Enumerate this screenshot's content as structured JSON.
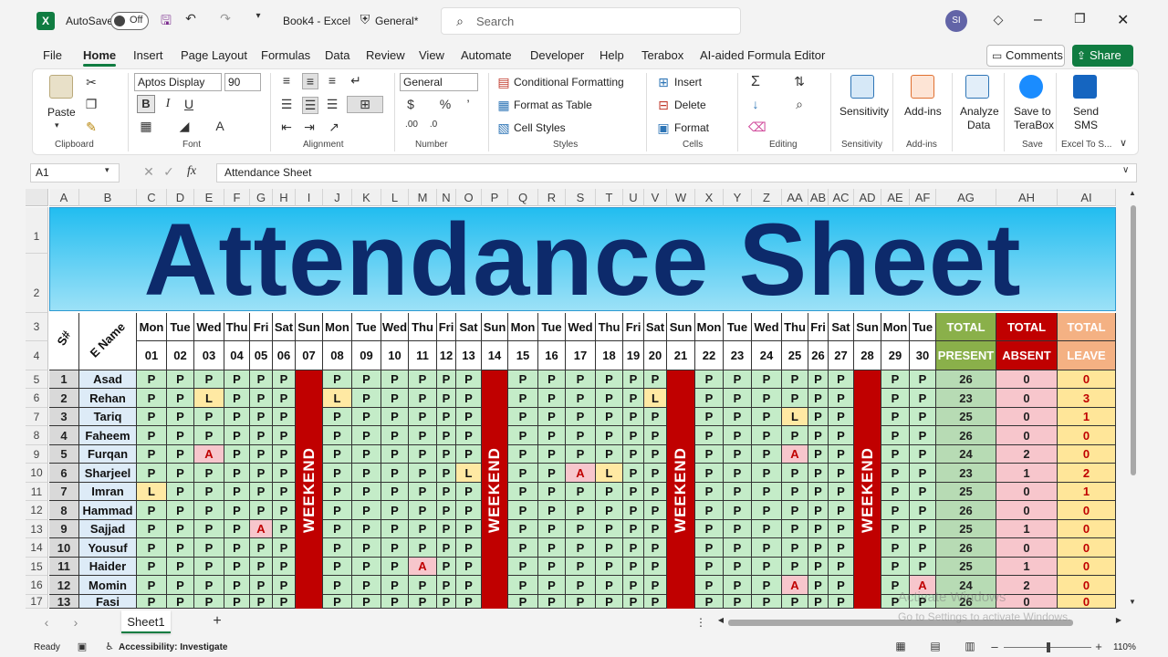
{
  "titlebar": {
    "app_icon": "X",
    "autosave_label": "AutoSave",
    "autosave_state": "Off",
    "doc_title": "Book4 - Excel",
    "sensitivity": "General*",
    "search_placeholder": "Search",
    "user_initials": "SI"
  },
  "menu": {
    "items": [
      "File",
      "Home",
      "Insert",
      "Page Layout",
      "Formulas",
      "Data",
      "Review",
      "View",
      "Automate",
      "Developer",
      "Help",
      "Terabox",
      "AI-aided Formula Editor"
    ],
    "active": "Home",
    "comments": "Comments",
    "share": "Share"
  },
  "ribbon": {
    "clipboard": {
      "paste": "Paste",
      "label": "Clipboard"
    },
    "font": {
      "name": "Aptos Display",
      "size": "90",
      "bold": "B",
      "italic": "I",
      "underline": "U",
      "label": "Font"
    },
    "alignment": {
      "label": "Alignment"
    },
    "number": {
      "format": "General",
      "label": "Number"
    },
    "styles": {
      "conditional": "Conditional Formatting",
      "format_table": "Format as Table",
      "cell_styles": "Cell Styles",
      "label": "Styles"
    },
    "cells": {
      "insert": "Insert",
      "delete": "Delete",
      "format": "Format",
      "label": "Cells"
    },
    "editing": {
      "label": "Editing"
    },
    "sensitivity": {
      "btn": "Sensitivity",
      "label": "Sensitivity"
    },
    "addins": {
      "btn": "Add-ins",
      "label": "Add-ins"
    },
    "analyze": {
      "line1": "Analyze",
      "line2": "Data"
    },
    "terabox": {
      "line1": "Save to",
      "line2": "TeraBox",
      "label": "Save"
    },
    "sms": {
      "line1": "Send",
      "line2": "SMS",
      "label": "Excel To S..."
    }
  },
  "formula_bar": {
    "cell_ref": "A1",
    "fx": "fx",
    "content": "Attendance Sheet"
  },
  "columns": [
    "A",
    "B",
    "C",
    "D",
    "E",
    "F",
    "G",
    "H",
    "I",
    "J",
    "K",
    "L",
    "M",
    "N",
    "O",
    "P",
    "Q",
    "R",
    "S",
    "T",
    "U",
    "V",
    "W",
    "X",
    "Y",
    "Z",
    "AA",
    "AB",
    "AC",
    "AD",
    "AE",
    "AF",
    "AG",
    "AH",
    "AI"
  ],
  "rows": [
    "1",
    "2",
    "3",
    "4",
    "5",
    "6",
    "7",
    "8",
    "9",
    "10",
    "11",
    "12",
    "13",
    "14",
    "15",
    "16",
    "17"
  ],
  "sheet": {
    "title": "Attendance Sheet",
    "hdr_sno": "S#",
    "hdr_name": "E Name",
    "days": [
      "Mon",
      "Tue",
      "Wed",
      "Thu",
      "Fri",
      "Sat",
      "Sun",
      "Mon",
      "Tue",
      "Wed",
      "Thu",
      "Fri",
      "Sat",
      "Sun",
      "Mon",
      "Tue",
      "Wed",
      "Thu",
      "Fri",
      "Sat",
      "Sun",
      "Mon",
      "Tue",
      "Wed",
      "Thu",
      "Fri",
      "Sat",
      "Sun",
      "Mon",
      "Tue"
    ],
    "dates": [
      "01",
      "02",
      "03",
      "04",
      "05",
      "06",
      "07",
      "08",
      "09",
      "10",
      "11",
      "12",
      "13",
      "14",
      "15",
      "16",
      "17",
      "18",
      "19",
      "20",
      "21",
      "22",
      "23",
      "24",
      "25",
      "26",
      "27",
      "28",
      "29",
      "30"
    ],
    "total": "TOTAL",
    "present": "PRESENT",
    "absent": "ABSENT",
    "leave": "LEAVE",
    "weekend": "WEEKEND",
    "employees": [
      {
        "sno": "1",
        "name": "Asad",
        "marks": "PPPPPP_PPPPPP_PPPPPP_PPPPPP_PP",
        "present": "26",
        "absent": "0",
        "leave": "0"
      },
      {
        "sno": "2",
        "name": "Rehan",
        "marks": "PPLPPP_LPPPPP_PPPPPL_PPPPPP_PP",
        "present": "23",
        "absent": "0",
        "leave": "3"
      },
      {
        "sno": "3",
        "name": "Tariq",
        "marks": "PPPPPP_PPPPPP_PPPPPP_PPPLPP_PP",
        "present": "25",
        "absent": "0",
        "leave": "1"
      },
      {
        "sno": "4",
        "name": "Faheem",
        "marks": "PPPPPP_PPPPPP_PPPPPP_PPPPPP_PP",
        "present": "26",
        "absent": "0",
        "leave": "0"
      },
      {
        "sno": "5",
        "name": "Furqan",
        "marks": "PPAPPP_PPPPPP_PPPPPP_PPPAPP_PP",
        "present": "24",
        "absent": "2",
        "leave": "0"
      },
      {
        "sno": "6",
        "name": "Sharjeel",
        "marks": "PPPPPP_PPPPPL_PPALPP_PPPPPP_PP",
        "present": "23",
        "absent": "1",
        "leave": "2"
      },
      {
        "sno": "7",
        "name": "Imran",
        "marks": "LPPPPP_PPPPPP_PPPPPP_PPPPPP_PP",
        "present": "25",
        "absent": "0",
        "leave": "1"
      },
      {
        "sno": "8",
        "name": "Hammad",
        "marks": "PPPPPP_PPPPPP_PPPPPP_PPPPPP_PP",
        "present": "26",
        "absent": "0",
        "leave": "0"
      },
      {
        "sno": "9",
        "name": "Sajjad",
        "marks": "PPPPAP_PPPPPP_PPPPPP_PPPPPP_PP",
        "present": "25",
        "absent": "1",
        "leave": "0"
      },
      {
        "sno": "10",
        "name": "Yousuf",
        "marks": "PPPPPP_PPPPPP_PPPPPP_PPPPPP_PP",
        "present": "26",
        "absent": "0",
        "leave": "0"
      },
      {
        "sno": "11",
        "name": "Haider",
        "marks": "PPPPPP_PPPAPP_PPPPPP_PPPPPP_PP",
        "present": "25",
        "absent": "1",
        "leave": "0"
      },
      {
        "sno": "12",
        "name": "Momin",
        "marks": "PPPPPP_PPPPPP_PPPPPP_PPPAPP_PA",
        "present": "24",
        "absent": "2",
        "leave": "0"
      },
      {
        "sno": "13",
        "name": "Fasi",
        "marks": "PPPPPP_PPPPPP_PPPPPP_PPPPPP_PP",
        "present": "26",
        "absent": "0",
        "leave": "0"
      }
    ]
  },
  "tabs": {
    "sheet1": "Sheet1",
    "add": "+"
  },
  "status": {
    "ready": "Ready",
    "accessibility": "Accessibility: Investigate",
    "zoom": "110%"
  },
  "watermark": {
    "line1": "Activate Windows",
    "line2": "Go to Settings to activate Windows."
  },
  "colors": {
    "excel_green": "#107c41",
    "banner_text": "#0d2a6b",
    "weekend": "#c00000",
    "present_cell": "#c4ecc8",
    "leave_cell": "#ffe9a3",
    "absent_cell": "#f7c6cc"
  }
}
